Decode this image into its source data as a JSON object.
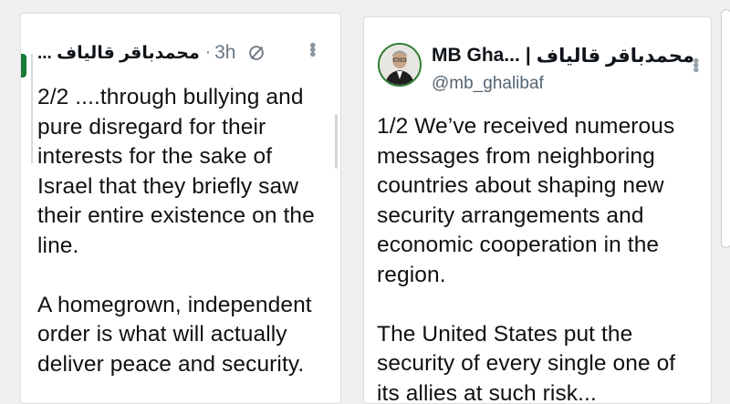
{
  "left_tweet": {
    "display_name": "محمدباقر قالیاف ...",
    "separator": "·",
    "time": "3h",
    "body": "2/2 ....through bullying and\npure disregard for their\ninterests for the sake of\nIsrael that they briefly saw\ntheir entire existence on the\nline.\n\nA homegrown, independent\norder is what will actually\ndeliver peace and security.",
    "icons": [
      "link-off-icon",
      "more-vertical-icon"
    ]
  },
  "right_tweet": {
    "display_name_latin": "MB Gha...",
    "display_name_sep": "|",
    "display_name_arabic": "محمدباقر قالیاف",
    "handle": "@mb_ghalibaf",
    "body": "1/2 We’ve received numerous\nmessages from neighboring\ncountries about shaping new\nsecurity arrangements and\neconomic cooperation in the\nregion.\n\nThe United States put the\nsecurity of every single one of\nits allies at such risk...",
    "icons": [
      "avatar",
      "more-vertical-icon"
    ]
  },
  "colors": {
    "background": "#efefef",
    "card": "#ffffff",
    "text": "#0f1419",
    "muted": "#6b7680",
    "accent_green": "#1a7a3a"
  }
}
